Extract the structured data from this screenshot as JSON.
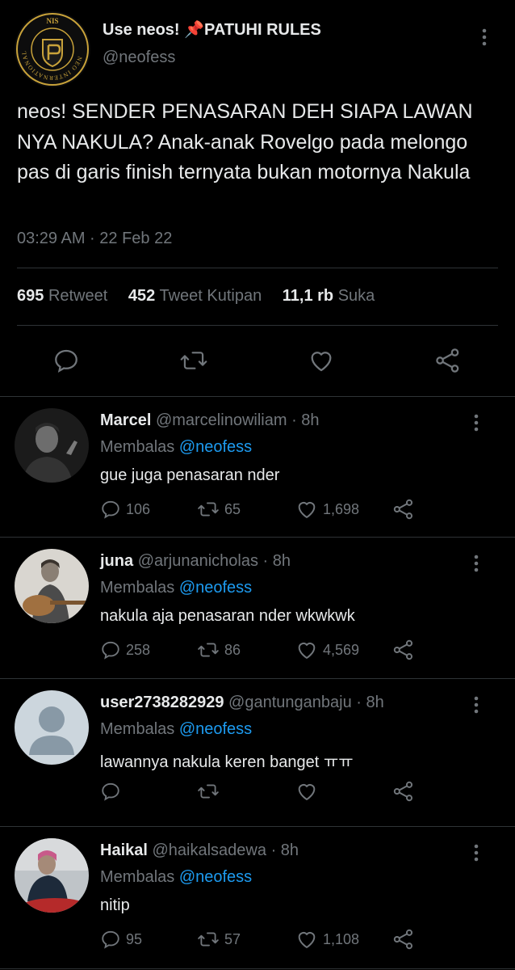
{
  "main_tweet": {
    "account_name": "Use neos! 📌PATUHI RULES",
    "handle": "@neofess",
    "avatar_text": "NIS",
    "avatar_ring_text": "NEO INTERNATIONAL SCHOOL",
    "text": "neos! SENDER PENASARAN DEH SIAPA LAWAN NYA NAKULA? Anak-anak Rovelgo pada melongo pas di garis finish ternyata bukan motornya Nakula",
    "timestamp": "03:29 AM · 22 Feb 22",
    "stats": [
      {
        "value": "695",
        "label": "Retweet"
      },
      {
        "value": "452",
        "label": "Tweet Kutipan"
      },
      {
        "value": "11,1 rb",
        "label": "Suka"
      }
    ],
    "icons": [
      "reply-icon",
      "retweet-icon",
      "like-icon",
      "share-icon",
      "more-icon"
    ]
  },
  "replies": [
    {
      "name": "Marcel",
      "handle": "@marcelinowiliam",
      "time": "· 8h",
      "replying_label": "Membalas",
      "replying_to": "@neofess",
      "text": "gue juga penasaran nder",
      "reply_count": "106",
      "retweet_count": "65",
      "like_count": "1,698"
    },
    {
      "name": "juna",
      "handle": "@arjunanicholas",
      "time": "· 8h",
      "replying_label": "Membalas",
      "replying_to": "@neofess",
      "text": "nakula aja penasaran nder wkwkwk",
      "reply_count": "258",
      "retweet_count": "86",
      "like_count": "4,569"
    },
    {
      "name": "user2738282929",
      "handle": "@gantunganbaju",
      "time": "· 8h",
      "replying_label": "Membalas",
      "replying_to": "@neofess",
      "text": "lawannya nakula keren banget ㅠㅠ",
      "reply_count": "",
      "retweet_count": "",
      "like_count": ""
    },
    {
      "name": "Haikal",
      "handle": "@haikalsadewa",
      "time": "· 8h",
      "replying_label": "Membalas",
      "replying_to": "@neofess",
      "text": "nitip",
      "reply_count": "95",
      "retweet_count": "57",
      "like_count": "1,108"
    }
  ],
  "colors": {
    "background": "#000000",
    "text_primary": "#e7e9ea",
    "text_secondary": "#71767b",
    "link": "#1d9bf0",
    "divider": "#2f3336",
    "badge_gold": "#c8a23a"
  }
}
